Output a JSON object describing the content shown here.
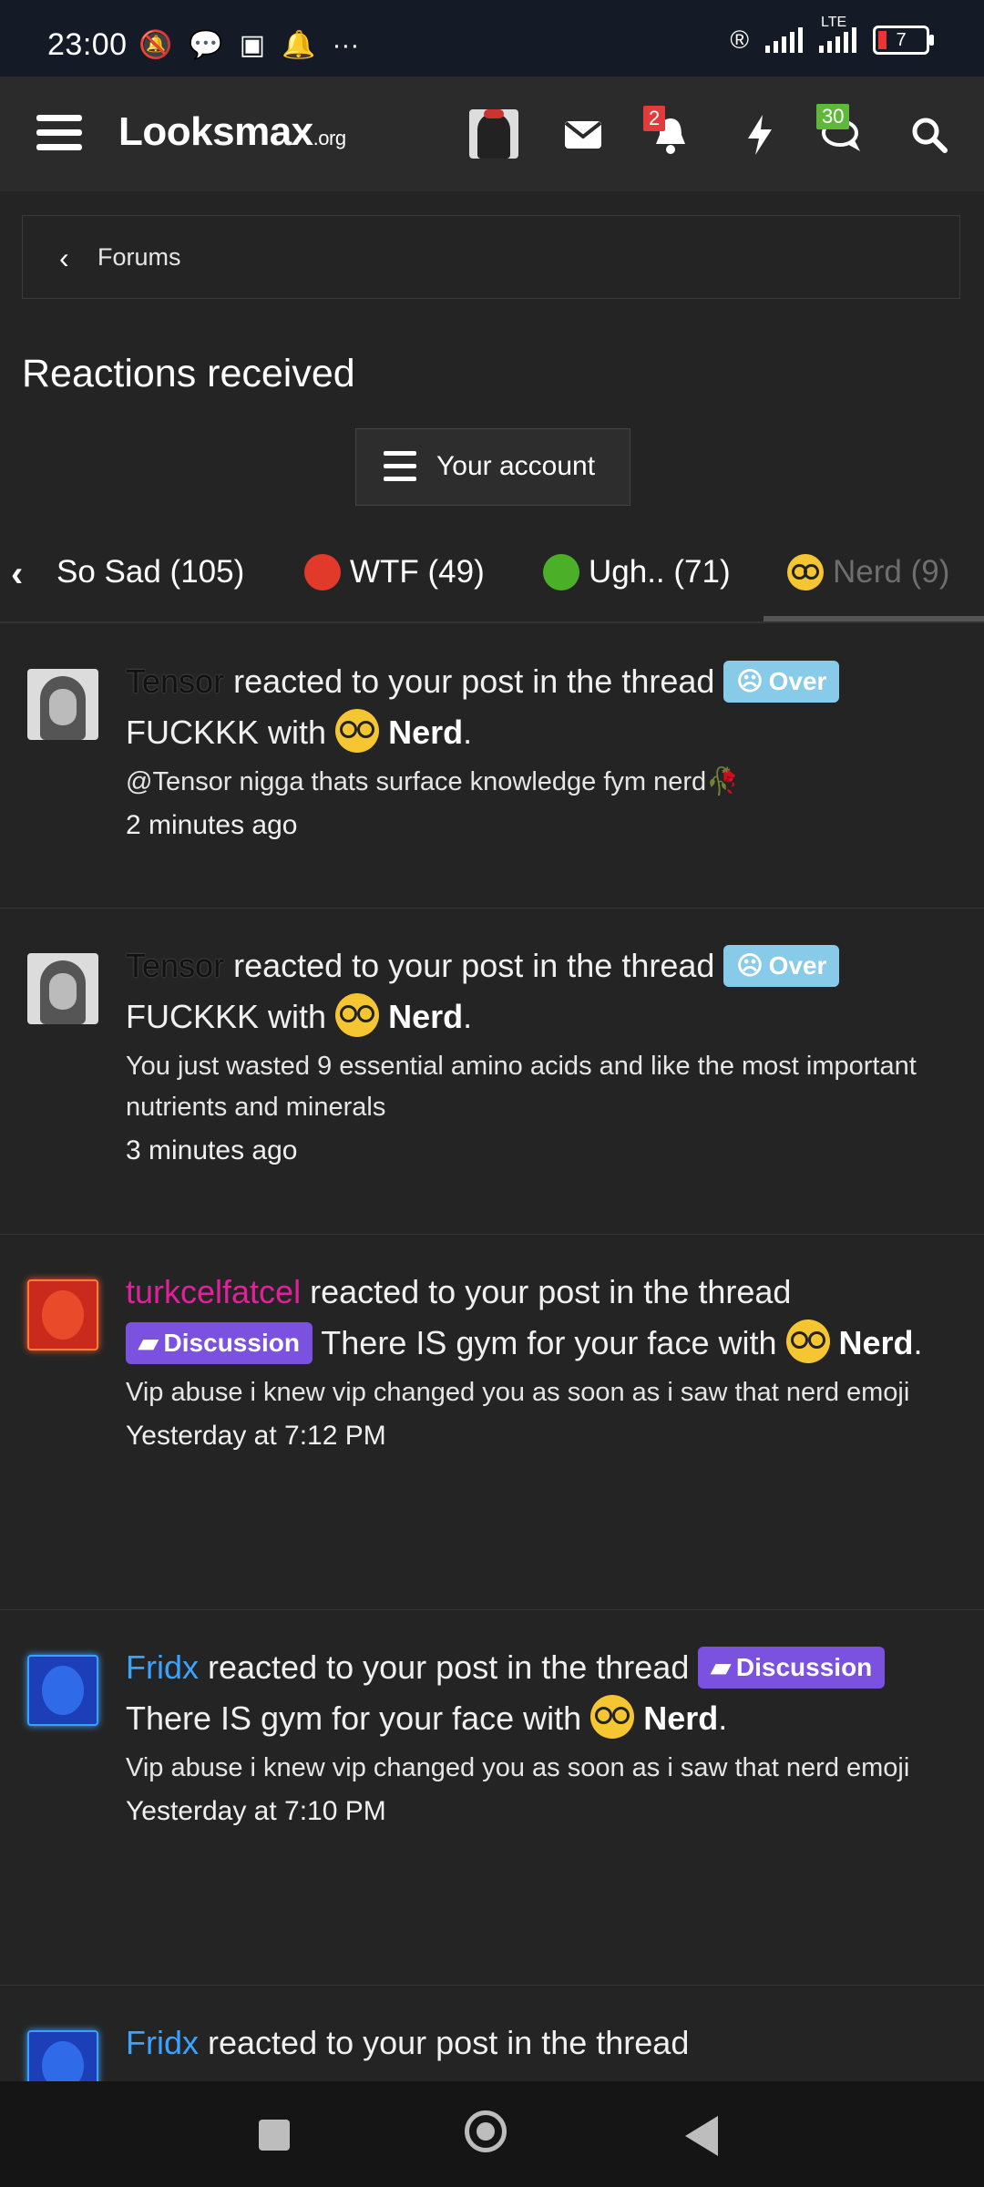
{
  "status": {
    "time": "23:00",
    "lte": "LTE",
    "battery": "7"
  },
  "header": {
    "logo_main": "Looksmax",
    "logo_suffix": ".org",
    "alerts_badge": "2",
    "conversations_badge": "30",
    "alerts_badge_color": "#e23b3b",
    "conversations_badge_color": "#5fb83a"
  },
  "breadcrumb": {
    "label": "Forums"
  },
  "page": {
    "title": "Reactions received",
    "account_button": "Your account"
  },
  "tabs": [
    {
      "label": "So Sad (105)",
      "icon": "sad-emoji"
    },
    {
      "label": "WTF (49)",
      "icon": "angry-emoji"
    },
    {
      "label": "Ugh.. (71)",
      "icon": "sick-emoji"
    },
    {
      "label": "Nerd (9)",
      "icon": "nerd-emoji",
      "active": true
    }
  ],
  "reactions": [
    {
      "user": "Tensor",
      "middle": "reacted to your post in the thread",
      "prefix": "Over",
      "thread": "FUCKKK with",
      "reaction": "Nerd",
      "snippet": "@Tensor nigga thats surface knowledge fym nerd🥀",
      "time": "2 minutes ago"
    },
    {
      "user": "Tensor",
      "middle": "reacted to your post in the thread",
      "prefix": "Over",
      "thread": "FUCKKK with",
      "reaction": "Nerd",
      "snippet": "You just wasted 9 essential amino acids and like the most important nutrients and minerals",
      "time": "3 minutes ago"
    },
    {
      "user": "turkcelfatcel",
      "middle": "reacted to your post in the thread",
      "prefix": "Discussion",
      "thread": "There IS gym for your face with",
      "reaction": "Nerd",
      "snippet": "Vip abuse i knew vip changed you as soon as i saw that nerd emoji",
      "time": "Yesterday at 7:12 PM"
    },
    {
      "user": "Fridx",
      "middle": "reacted to your post in the thread",
      "prefix": "Discussion",
      "thread": "There IS gym for your face with",
      "reaction": "Nerd",
      "snippet": "Vip abuse i knew vip changed you as soon as i saw that nerd emoji",
      "time": "Yesterday at 7:10 PM"
    },
    {
      "user": "Fridx",
      "middle": "reacted to your post in the thread"
    }
  ]
}
